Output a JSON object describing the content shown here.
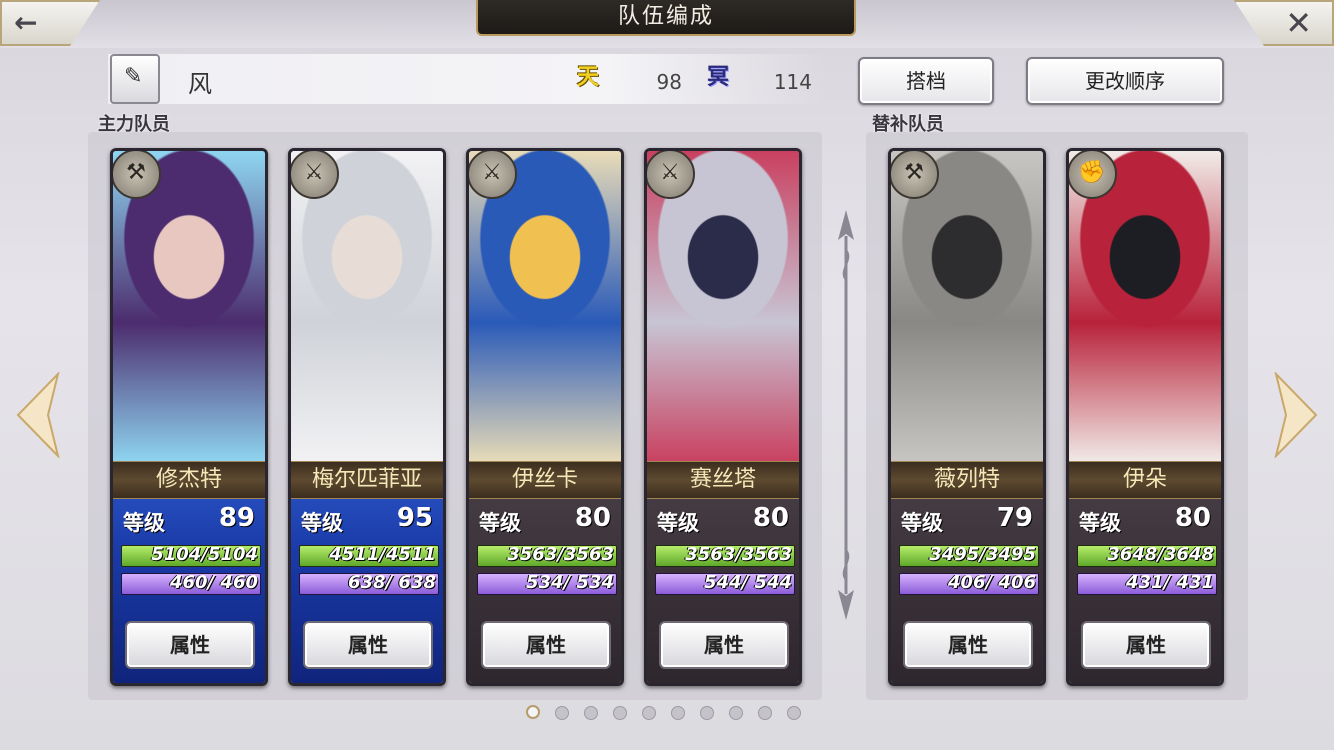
{
  "header": {
    "title": "队伍编成",
    "back_icon": "back-arrow-icon",
    "close_icon": "close-icon"
  },
  "team": {
    "name": "风",
    "sky_icon_text": "天",
    "sky_value": "98",
    "hell_icon_text": "冥",
    "hell_value": "114"
  },
  "buttons": {
    "partner": "搭档",
    "change_order": "更改顺序"
  },
  "sections": {
    "main": "主力队员",
    "sub": "替补队员"
  },
  "main_members": [
    {
      "name": "修杰特",
      "level_label": "等级",
      "level": "89",
      "hp": "5104/5104",
      "mp": "460/ 460",
      "attr_label": "属性",
      "weapon": "axe-icon",
      "theme": "blue",
      "portrait_colors": [
        "#8fd6f2",
        "#4c2c6e",
        "#e7c7c0"
      ]
    },
    {
      "name": "梅尔匹菲亚",
      "level_label": "等级",
      "level": "95",
      "hp": "4511/4511",
      "mp": "638/ 638",
      "attr_label": "属性",
      "weapon": "sword-icon",
      "theme": "blue",
      "portrait_colors": [
        "#f2f2f4",
        "#cfd2d8",
        "#e8ddd6"
      ]
    },
    {
      "name": "伊丝卡",
      "level_label": "等级",
      "level": "80",
      "hp": "3563/3563",
      "mp": "534/ 534",
      "attr_label": "属性",
      "weapon": "katana-icon",
      "theme": "dark",
      "portrait_colors": [
        "#e9dcb8",
        "#2a5ab8",
        "#f0c050"
      ]
    },
    {
      "name": "赛丝塔",
      "level_label": "等级",
      "level": "80",
      "hp": "3563/3563",
      "mp": "544/ 544",
      "attr_label": "属性",
      "weapon": "blade-icon",
      "theme": "dark",
      "portrait_colors": [
        "#c94060",
        "#c7c5d4",
        "#2b2b4a"
      ]
    }
  ],
  "sub_members": [
    {
      "name": "薇列特",
      "level_label": "等级",
      "level": "79",
      "hp": "3495/3495",
      "mp": "406/ 406",
      "attr_label": "属性",
      "weapon": "hammer-icon",
      "theme": "dark",
      "portrait_colors": [
        "#c8c6c2",
        "#8a8884",
        "#2d2d30"
      ]
    },
    {
      "name": "伊朵",
      "level_label": "等级",
      "level": "80",
      "hp": "3648/3648",
      "mp": "431/ 431",
      "attr_label": "属性",
      "weapon": "fist-icon",
      "theme": "dark",
      "portrait_colors": [
        "#f1ece8",
        "#b8223a",
        "#1d1d24"
      ]
    }
  ],
  "pager": {
    "total": 10,
    "active": 1
  }
}
